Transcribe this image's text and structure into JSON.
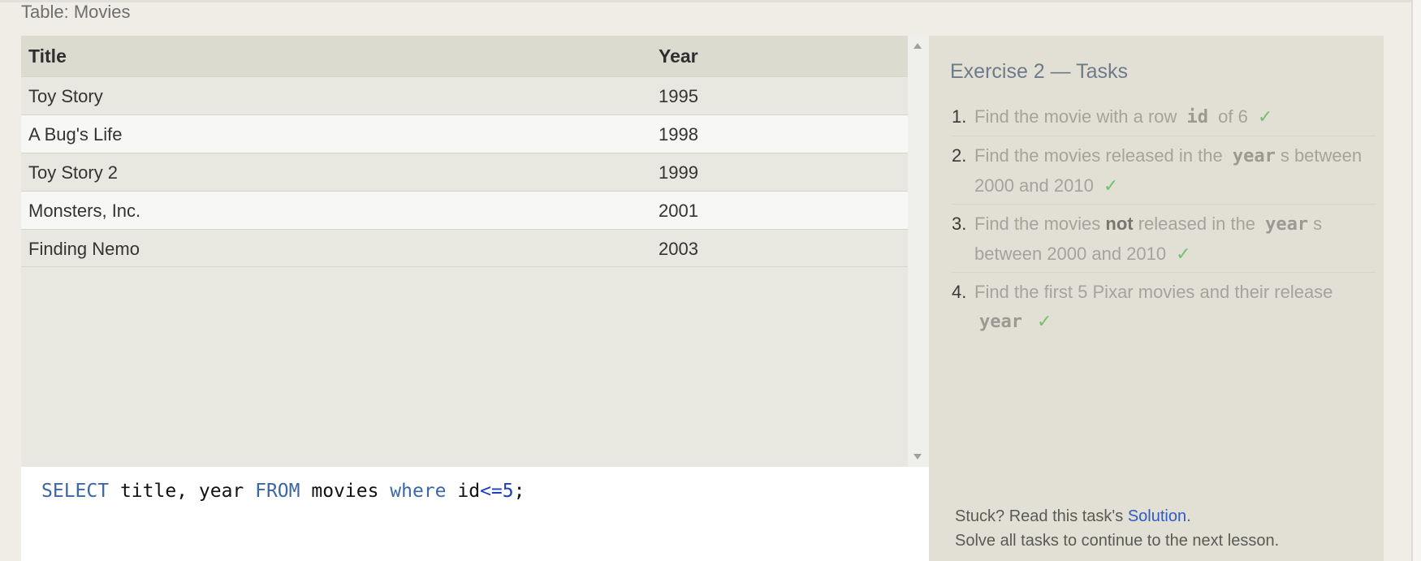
{
  "table": {
    "caption": "Table: Movies",
    "columns": [
      "Title",
      "Year"
    ],
    "rows": [
      [
        "Toy Story",
        "1995"
      ],
      [
        "A Bug's Life",
        "1998"
      ],
      [
        "Toy Story 2",
        "1999"
      ],
      [
        "Monsters, Inc.",
        "2001"
      ],
      [
        "Finding Nemo",
        "2003"
      ]
    ]
  },
  "query": {
    "kw_select": "SELECT",
    "cols": " title, year ",
    "kw_from": "FROM",
    "table": " movies ",
    "kw_where": "where",
    "col": " id",
    "op": "<=",
    "num": "5",
    "end": ";"
  },
  "tasks": {
    "title": "Exercise 2 — Tasks",
    "items": [
      {
        "n": "1.",
        "a": "Find the movie with a row ",
        "code1": "id",
        "b": " of 6",
        "check": "✓"
      },
      {
        "n": "2.",
        "a": "Find the movies released in the ",
        "code1": "year",
        "b": "s between 2000 and 2010",
        "check": "✓"
      },
      {
        "n": "3.",
        "a": "Find the movies ",
        "bold": "not",
        "a2": " released in the ",
        "code1": "year",
        "b": "s between 2000 and 2010",
        "check": "✓"
      },
      {
        "n": "4.",
        "a": "Find the first 5 Pixar movies and their release ",
        "code1": "year",
        "b": "",
        "check": "✓"
      }
    ],
    "footer_prefix": "Stuck? Read this task's ",
    "footer_link": "Solution",
    "footer_suffix": ".",
    "footer_line2": "Solve all tasks to continue to the next lesson."
  },
  "colors": {
    "keyword": "#3b67a8",
    "check": "#71c171",
    "link": "#2f5ac8"
  }
}
